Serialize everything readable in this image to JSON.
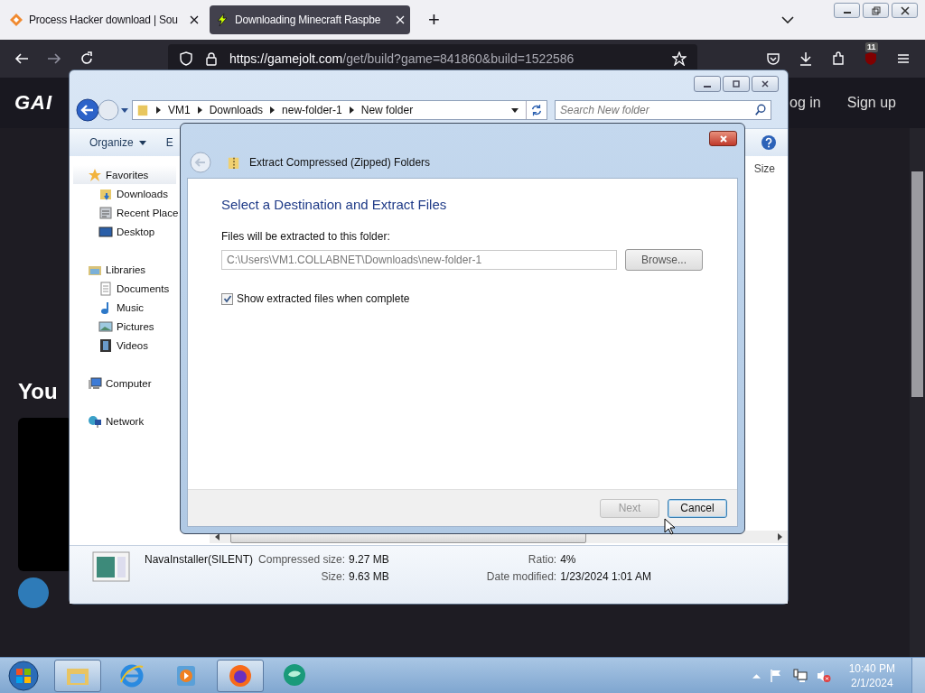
{
  "browser": {
    "tabs": [
      {
        "title": "Process Hacker download | Sou",
        "selected": false,
        "kind": "diamond"
      },
      {
        "title": "Downloading Minecraft Raspbe",
        "selected": true,
        "kind": "bolt"
      }
    ],
    "new_tab": "+",
    "address": {
      "host": "https://gamejolt.com",
      "path": "/get/build?game=841860&build=1522586"
    },
    "badge": "11"
  },
  "site": {
    "logo": "GAI",
    "login": "og in",
    "signup": "Sign up",
    "heading": "You"
  },
  "explorer": {
    "breadcrumb": [
      "VM1",
      "Downloads",
      "new-folder-1",
      "New folder"
    ],
    "search_placeholder": "Search New folder",
    "toolbar": [
      {
        "label": "Organize",
        "menu": true
      },
      {
        "label": "E",
        "menu": false
      }
    ],
    "column": "Size",
    "nav": [
      {
        "label": "Favorites",
        "kind": "star",
        "selected": true,
        "children": [
          {
            "label": "Downloads",
            "kind": "downloads",
            "selected": false
          },
          {
            "label": "Recent Place",
            "kind": "recent",
            "selected": false
          },
          {
            "label": "Desktop",
            "kind": "desktop",
            "selected": false
          }
        ]
      },
      {
        "label": "Libraries",
        "kind": "library",
        "selected": false,
        "children": [
          {
            "label": "Documents",
            "kind": "document",
            "selected": false
          },
          {
            "label": "Music",
            "kind": "music",
            "selected": false
          },
          {
            "label": "Pictures",
            "kind": "pictures",
            "selected": false
          },
          {
            "label": "Videos",
            "kind": "videos",
            "selected": false
          }
        ]
      },
      {
        "label": "Computer",
        "kind": "computer",
        "selected": false
      },
      {
        "label": "Network",
        "kind": "network",
        "selected": false
      }
    ],
    "details": {
      "name": "NavaInstaller(SILENT)",
      "left": [
        {
          "label": "Compressed size:",
          "value": "9.27 MB"
        },
        {
          "label": "Size:",
          "value": "9.63 MB"
        }
      ],
      "right": [
        {
          "label": "Ratio:",
          "value": "4%"
        },
        {
          "label": "Date modified:",
          "value": "1/23/2024 1:01 AM"
        }
      ]
    }
  },
  "dialog": {
    "title": "Extract Compressed (Zipped) Folders",
    "heading": "Select a Destination and Extract Files",
    "field_label": "Files will be extracted to this folder:",
    "path": "C:\\Users\\VM1.COLLABNET\\Downloads\\new-folder-1",
    "browse": "Browse...",
    "checkbox": {
      "label": "Show extracted files when complete",
      "checked": true
    },
    "buttons": [
      {
        "label": "Next",
        "disabled": true
      },
      {
        "label": "Cancel",
        "disabled": false
      }
    ]
  },
  "taskbar": {
    "apps": [
      {
        "kind": "explorer",
        "selected": true
      },
      {
        "kind": "ie",
        "selected": false
      },
      {
        "kind": "media",
        "selected": false
      },
      {
        "kind": "firefox",
        "selected": true
      },
      {
        "kind": "chat",
        "selected": false
      }
    ],
    "time": "10:40 PM",
    "date": "2/1/2024"
  }
}
